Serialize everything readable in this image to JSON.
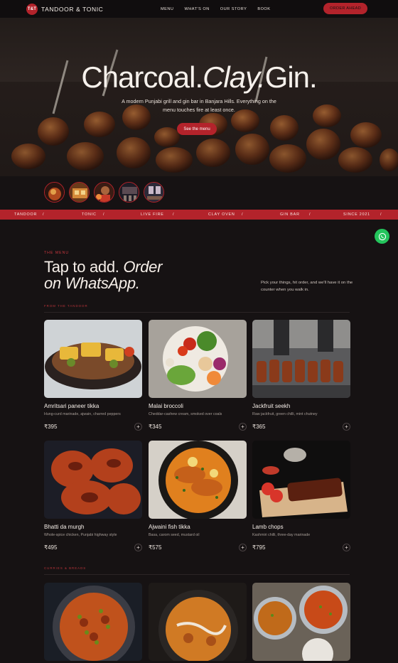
{
  "nav": {
    "logo_text": "T&T",
    "brand": "TANDOOR & TONIC",
    "links": [
      "MENU",
      "WHAT'S ON",
      "OUR STORY",
      "BOOK"
    ],
    "order_button": "ORDER AHEAD"
  },
  "hero": {
    "title_part1": "Charcoal.",
    "title_part2": "Clay.",
    "title_part3": "Gin.",
    "subtitle": "A modern Punjabi grill and gin bar in Banjara Hills. Everything on the menu touches fire at least once.",
    "button": "See the menu"
  },
  "ticker": [
    "TANDOOR",
    "/",
    "TONIC",
    "/",
    "LIVE FIRE",
    "/",
    "CLAY OVEN",
    "/",
    "GIN BAR",
    "/",
    "SINCE 2021",
    "/"
  ],
  "menu": {
    "eyebrow": "THE MENU",
    "title_line1": "Tap to add.",
    "title_italic1": "Order",
    "title_line2": "on WhatsApp.",
    "note": "Pick your things, hit order, and we'll have it on the counter when you walk in.",
    "section1": "FROM THE TANDOOR",
    "section2": "CURRIES & BREADS"
  },
  "items": [
    {
      "name": "Amritsari paneer tikka",
      "desc": "Hung-curd marinade, ajwain, charred peppers",
      "price": "₹395",
      "add": "+"
    },
    {
      "name": "Malai broccoli",
      "desc": "Cheddar-cashew cream, smoked over coals",
      "price": "₹345",
      "add": "+"
    },
    {
      "name": "Jackfruit seekh",
      "desc": "Raw jackfruit, green chilli, mint chutney",
      "price": "₹365",
      "add": "+"
    },
    {
      "name": "Bhatti da murgh",
      "desc": "Whole-spice chicken, Punjabi highway style",
      "price": "₹495",
      "add": "+"
    },
    {
      "name": "Ajwaini fish tikka",
      "desc": "Basa, carom seed, mustard oil",
      "price": "₹575",
      "add": "+"
    },
    {
      "name": "Lamb chops",
      "desc": "Kashmiri chilli, three-day marinade",
      "price": "₹795",
      "add": "+"
    }
  ],
  "colors": {
    "accent": "#b3232b",
    "background": "#161213",
    "whatsapp": "#24c45c"
  }
}
